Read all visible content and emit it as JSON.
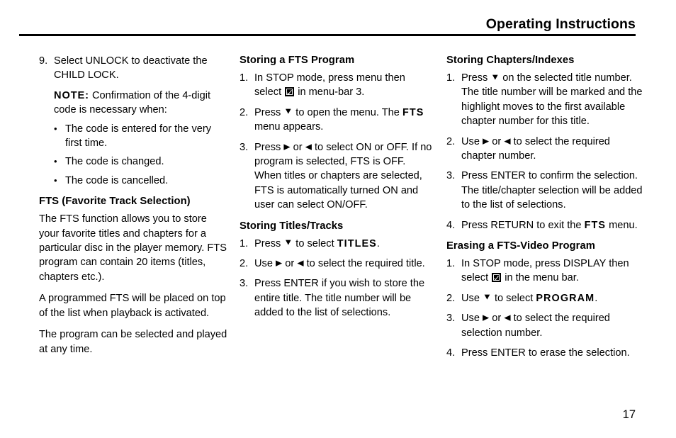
{
  "header": {
    "title": "Operating Instructions"
  },
  "footer": {
    "page_number": "17"
  },
  "icons": {
    "checkbox_checked": "checkbox-checked-icon",
    "arrow_down": "▼",
    "arrow_right": "▶",
    "arrow_left": "◀"
  },
  "columns": {
    "left": {
      "step9": {
        "num": "9.",
        "text": "Select UNLOCK to deactivate the CHILD LOCK."
      },
      "note": {
        "label": "NOTE:",
        "text": " Confirmation of the 4-digit code is necessary when:"
      },
      "bullets": [
        "The code is entered for the very first time.",
        "The code is changed.",
        "The code is cancelled."
      ],
      "fts_heading": "FTS (Favorite Track Selection)",
      "fts_para1": "The FTS function allows you to store your favorite titles and chapters for a particular disc in the player memory. FTS program can contain 20 items (titles, chapters etc.).",
      "fts_para2": "A programmed FTS will be placed on top of the list when playback is activated.",
      "fts_para3": "The program can be selected and played at any time."
    },
    "middle": {
      "storing_program_heading": "Storing a FTS Program",
      "sp_step1": {
        "num": "1.",
        "pre": "In STOP mode, press menu then select ",
        "post": " in menu-bar 3."
      },
      "sp_step2": {
        "num": "2.",
        "pre": "Press ",
        "mid": " to open the menu.  The ",
        "kw": "FTS",
        "post": " menu appears."
      },
      "sp_step3": {
        "num": "3.",
        "pre": "Press ",
        "mid": " or ",
        "post": " to select ON or OFF. If no program is selected, FTS is OFF. When titles or chapters are selected, FTS is automatically turned ON and user can select ON/OFF."
      },
      "storing_titles_heading": "Storing Titles/Tracks",
      "st_step1": {
        "num": "1.",
        "pre": "Press ",
        "mid": " to select ",
        "kw": "TITLES",
        "post": "."
      },
      "st_step2": {
        "num": "2.",
        "pre": "Use ",
        "mid": " or ",
        "post": " to select the required title."
      },
      "st_step3": {
        "num": "3.",
        "text": "Press ENTER if you wish to store the entire title.  The title number will be added to the list of selections."
      }
    },
    "right": {
      "storing_chapters_heading": "Storing Chapters/Indexes",
      "sc_step1": {
        "num": "1.",
        "pre": "Press ",
        "post": " on the selected title number.  The title number will be marked and the highlight moves to the first available chapter number for this title."
      },
      "sc_step2": {
        "num": "2.",
        "pre": "Use ",
        "mid": " or ",
        "post": " to select the required chapter number."
      },
      "sc_step3": {
        "num": "3.",
        "text": "Press ENTER to confirm the selection. The title/chapter selection will be added to the list of selections."
      },
      "sc_step4": {
        "num": "4.",
        "pre": "Press RETURN to exit the ",
        "kw": "FTS",
        "post": " menu."
      },
      "erasing_heading": "Erasing a FTS-Video Program",
      "er_step1": {
        "num": "1.",
        "pre": "In STOP mode, press DISPLAY then select ",
        "post": " in the menu bar."
      },
      "er_step2": {
        "num": "2.",
        "pre": "Use ",
        "mid": " to select ",
        "kw": "PROGRAM",
        "post": "."
      },
      "er_step3": {
        "num": "3.",
        "pre": "Use ",
        "mid": " or ",
        "post": " to select the required selection number."
      },
      "er_step4": {
        "num": "4.",
        "text": "Press ENTER to erase the selection."
      }
    }
  }
}
